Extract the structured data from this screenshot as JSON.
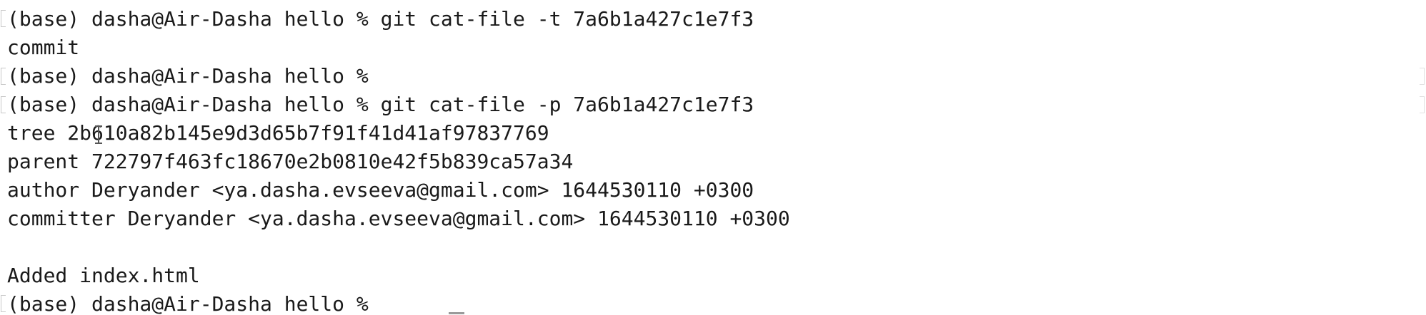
{
  "terminal": {
    "lines": [
      "(base) dasha@Air-Dasha hello % git cat-file -t 7a6b1a427c1e7f3",
      "commit",
      "(base) dasha@Air-Dasha hello %",
      "(base) dasha@Air-Dasha hello % git cat-file -p 7a6b1a427c1e7f3",
      "tree 2b610a82b145e9d3d65b7f91f41d41af97837769",
      "parent 722797f463fc18670e2b0810e42f5b839ca57a34",
      "author Deryander <ya.dasha.evseeva@gmail.com> 1644530110 +0300",
      "committer Deryander <ya.dasha.evseeva@gmail.com> 1644530110 +0300",
      "",
      "Added index.html",
      "(base) dasha@Air-Dasha hello %"
    ]
  }
}
